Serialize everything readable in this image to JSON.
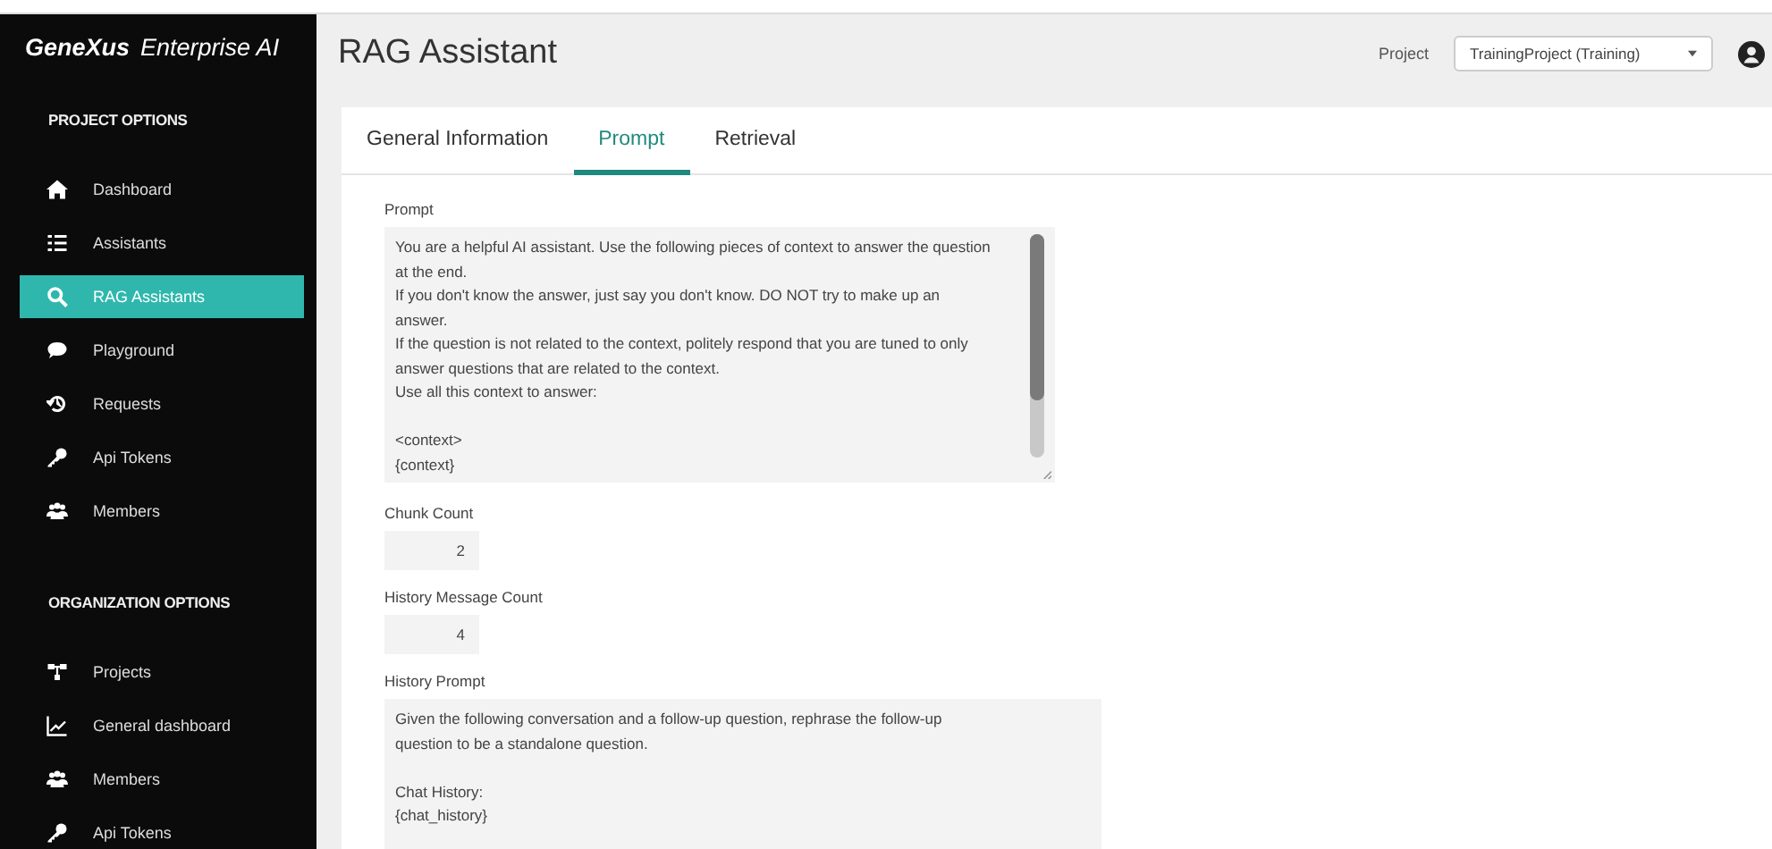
{
  "brand": {
    "name": "GeneXus",
    "suffix": "Enterprise AI"
  },
  "sidebar": {
    "sections": [
      {
        "title": "PROJECT OPTIONS",
        "items": [
          {
            "label": "Dashboard",
            "selected": false
          },
          {
            "label": "Assistants",
            "selected": false
          },
          {
            "label": "RAG Assistants",
            "selected": true
          },
          {
            "label": "Playground",
            "selected": false
          },
          {
            "label": "Requests",
            "selected": false
          },
          {
            "label": "Api Tokens",
            "selected": false
          },
          {
            "label": "Members",
            "selected": false
          }
        ]
      },
      {
        "title": "ORGANIZATION OPTIONS",
        "items": [
          {
            "label": "Projects",
            "selected": false
          },
          {
            "label": "General dashboard",
            "selected": false
          },
          {
            "label": "Members",
            "selected": false
          },
          {
            "label": "Api Tokens",
            "selected": false
          }
        ]
      }
    ]
  },
  "header": {
    "title": "RAG Assistant",
    "project_label": "Project",
    "project_value": "TrainingProject (Training)"
  },
  "tabs": [
    {
      "label": "General Information",
      "selected": false
    },
    {
      "label": "Prompt",
      "selected": true
    },
    {
      "label": "Retrieval",
      "selected": false
    }
  ],
  "fields": [
    {
      "kind": "textarea",
      "label": "Prompt",
      "paragraphs": [
        [
          "You are a helpful AI assistant. Use the following pieces of context to answer the question",
          "at the end.",
          "If you don't know the answer, just say you don't know. DO NOT try to make up an",
          "answer.",
          "If the question is not related to the context, politely respond that you are tuned to only",
          "answer questions that are related to the context.",
          "Use all this context to answer:"
        ],
        [
          "<context>",
          "{context}"
        ]
      ]
    },
    {
      "kind": "number",
      "label": "Chunk Count",
      "value": "2"
    },
    {
      "kind": "number",
      "label": "History Message Count",
      "value": "4"
    },
    {
      "kind": "textarea",
      "label": "History Prompt",
      "paragraphs": [
        [
          "Given the following conversation and a follow-up question, rephrase the follow-up",
          "question to be a standalone question."
        ],
        [
          "Chat History:",
          "{chat_history}"
        ]
      ]
    }
  ]
}
